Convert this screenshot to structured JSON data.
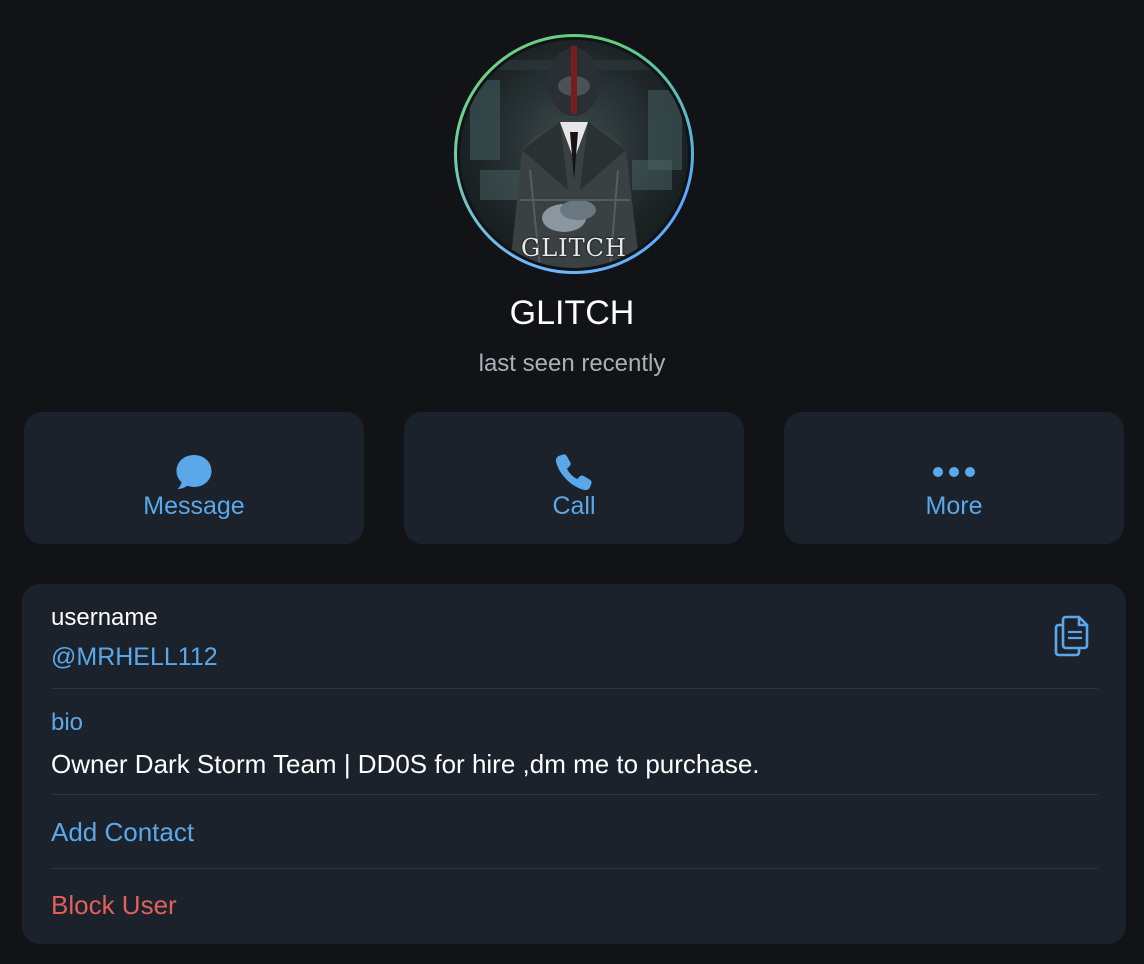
{
  "profile": {
    "avatar_caption": "GLITCH",
    "name": "GLITCH",
    "status": "last seen recently"
  },
  "actions": [
    {
      "label": "Message",
      "icon": "chat-bubble-icon"
    },
    {
      "label": "Call",
      "icon": "phone-icon"
    },
    {
      "label": "More",
      "icon": "more-dots-icon"
    }
  ],
  "info": {
    "username_label": "username",
    "username_value": "@MRHELL112",
    "copy_icon": "copy-icon",
    "bio_label": "bio",
    "bio_value": "Owner Dark Storm Team | DD0S for hire ,dm me to purchase.",
    "add_contact": "Add Contact",
    "block_user": "Block User"
  },
  "colors": {
    "background": "#111316",
    "card": "#1b222c",
    "accent": "#5aa8ea",
    "danger": "#e0605a",
    "text_primary": "#ffffff",
    "text_secondary": "#a9b0b8"
  }
}
